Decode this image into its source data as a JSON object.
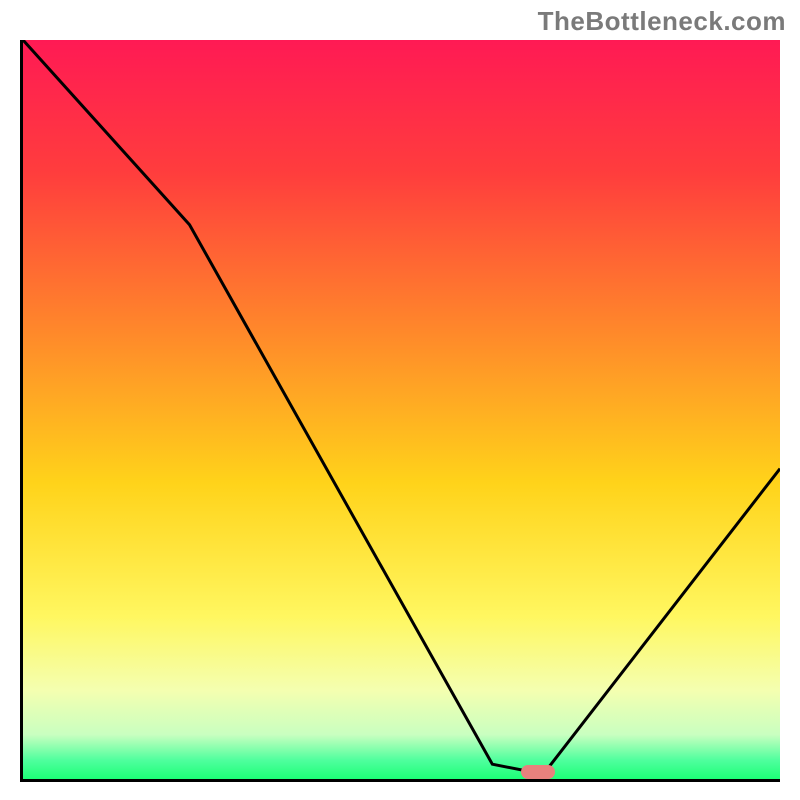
{
  "watermark": "TheBottleneck.com",
  "chart_data": {
    "type": "line",
    "title": "",
    "xlabel": "",
    "ylabel": "",
    "xlim": [
      0,
      100
    ],
    "ylim": [
      0,
      100
    ],
    "x": [
      0,
      22,
      62,
      67,
      69,
      100
    ],
    "values": [
      100,
      75,
      2,
      1,
      1,
      42
    ],
    "marker": {
      "x": 68,
      "y": 1,
      "color": "#e8817d"
    },
    "gradient_stops": [
      {
        "pos": 0.0,
        "color": "#ff1a54"
      },
      {
        "pos": 0.18,
        "color": "#ff3d3d"
      },
      {
        "pos": 0.4,
        "color": "#ff8a2a"
      },
      {
        "pos": 0.6,
        "color": "#ffd31a"
      },
      {
        "pos": 0.78,
        "color": "#fff760"
      },
      {
        "pos": 0.88,
        "color": "#f4ffb0"
      },
      {
        "pos": 0.94,
        "color": "#c9ffc0"
      },
      {
        "pos": 0.975,
        "color": "#4eff9d"
      },
      {
        "pos": 1.0,
        "color": "#1dff77"
      }
    ],
    "curve_color": "#000000",
    "curve_width": 3
  }
}
